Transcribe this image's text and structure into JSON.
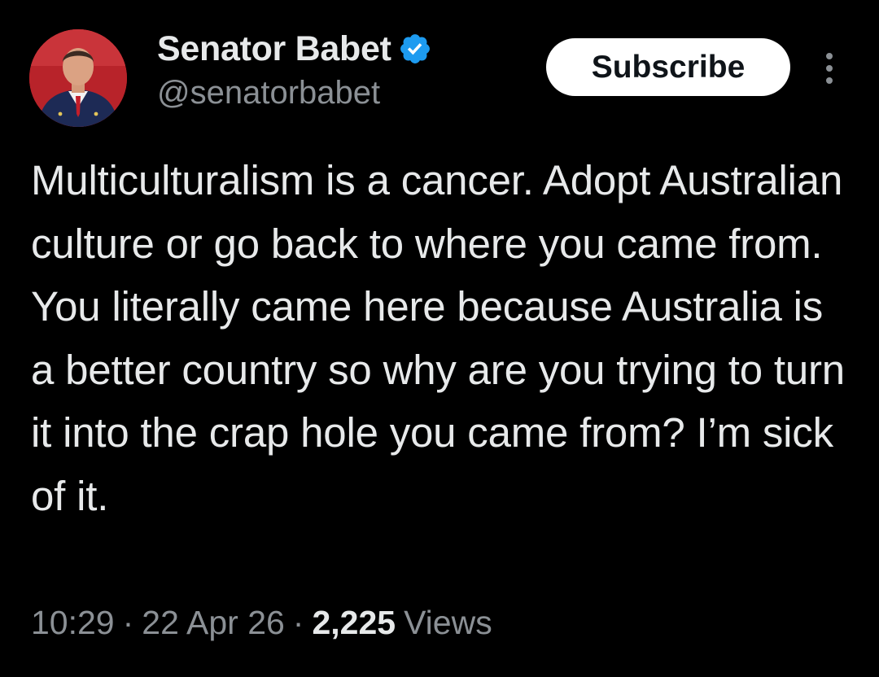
{
  "author": {
    "display_name": "Senator Babet",
    "handle": "@senatorbabet",
    "verified": true,
    "avatar_icon": "profile-photo-man-in-suit"
  },
  "actions": {
    "subscribe_label": "Subscribe",
    "more_icon": "more-vertical-icon"
  },
  "tweet": {
    "text": "Multiculturalism is a cancer. Adopt Australian culture or go back to where you came from. You literally came here because Australia is a better country so why are you trying to turn it into the crap hole you came from? I’m sick of it."
  },
  "meta": {
    "time": "10:29",
    "separator": "·",
    "date": "22 Apr 26",
    "views_count": "2,225",
    "views_label": "Views"
  },
  "colors": {
    "background": "#000000",
    "text_primary": "#e7e9ea",
    "text_secondary": "#8b9095",
    "verified_blue": "#1d9bf0",
    "button_bg": "#ffffff"
  }
}
